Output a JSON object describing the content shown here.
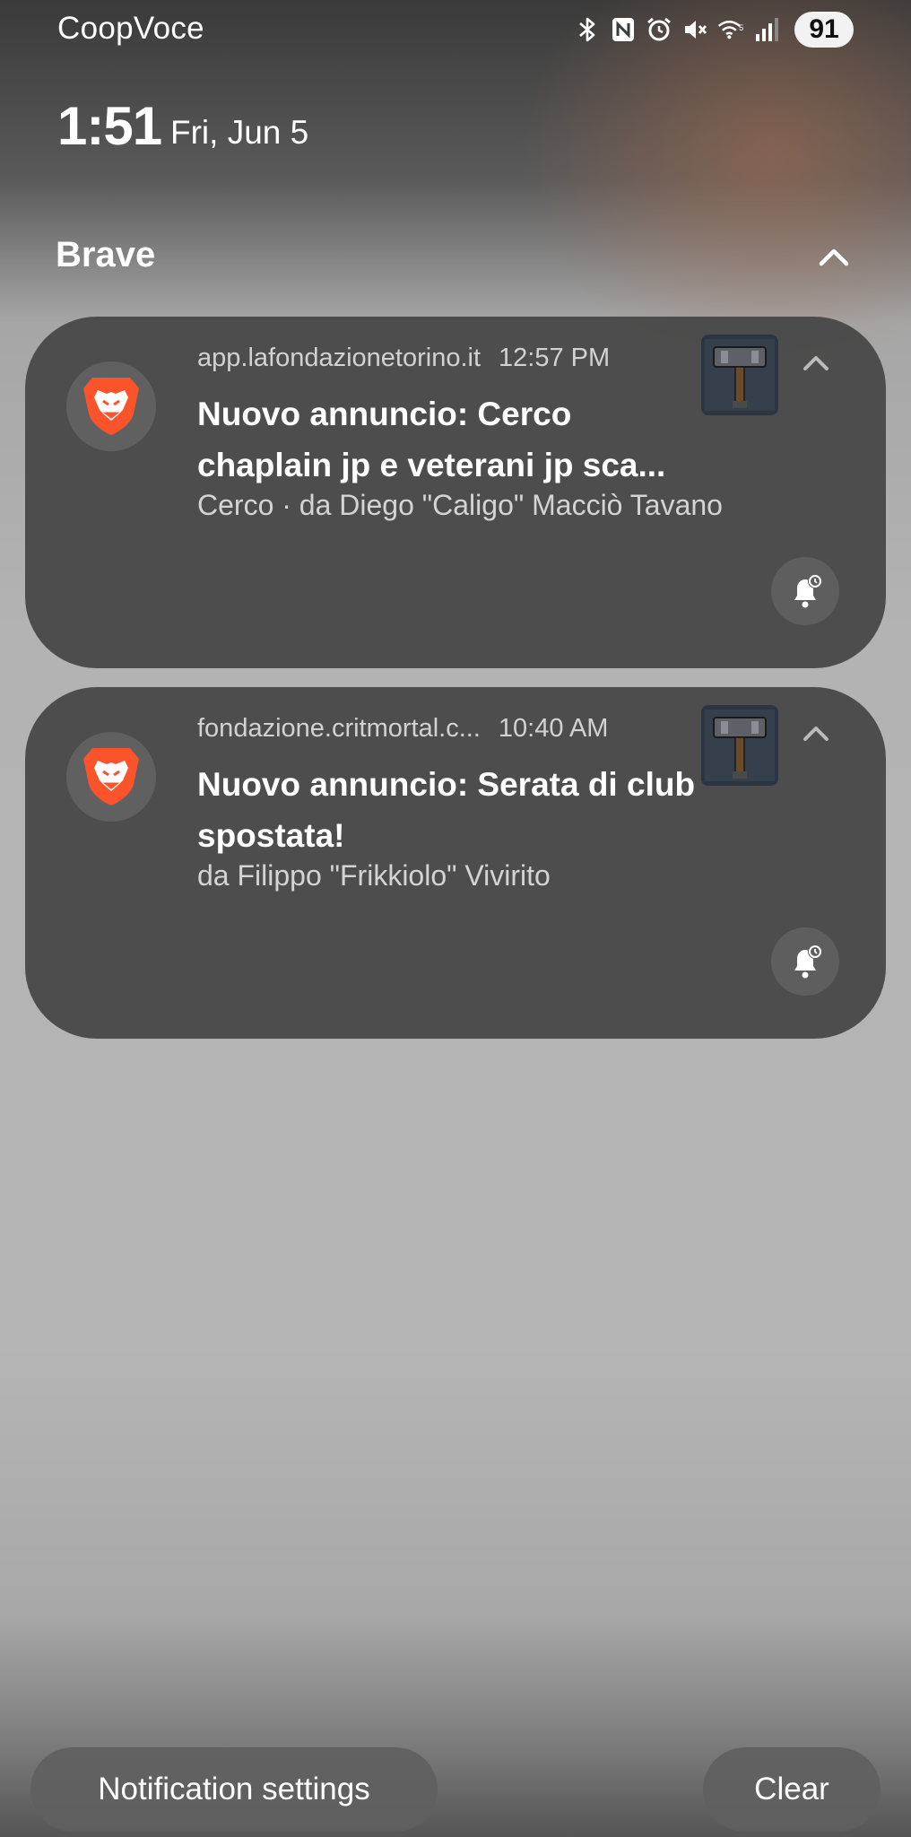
{
  "status_bar": {
    "carrier": "CoopVoce",
    "icons": [
      "bluetooth-icon",
      "nfc-icon",
      "alarm-icon",
      "mute-icon",
      "wifi-icon",
      "signal-icon"
    ],
    "battery": "91"
  },
  "lock": {
    "time": "1:51",
    "date": "Fri, Jun 5"
  },
  "group": {
    "app_name": "Brave"
  },
  "notifications": [
    {
      "source": "app.lafondazionetorino.it",
      "time": "12:57 PM",
      "title": "Nuovo annuncio: Cerco chaplain jp e veterani jp sca...",
      "body": "Cerco · da Diego \"Caligo\" Macciò Tavano"
    },
    {
      "source": "fondazione.critmortal.c...",
      "time": "10:40 AM",
      "title": "Nuovo annuncio: Serata di club spostata!",
      "body": "da Filippo \"Frikkiolo\" Vivirito"
    }
  ],
  "footer": {
    "settings_label": "Notification settings",
    "clear_label": "Clear"
  },
  "colors": {
    "brave_orange": "#fb542b",
    "card": "#484848"
  }
}
